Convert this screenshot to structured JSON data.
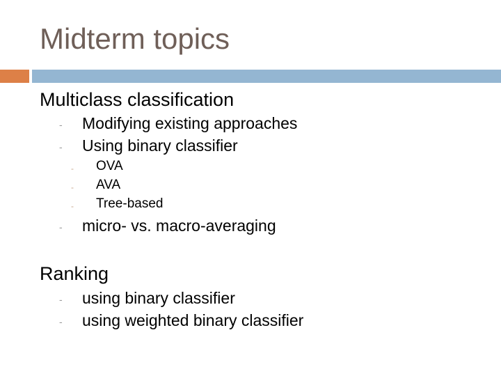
{
  "slide": {
    "title": "Midterm topics",
    "accent_colors": {
      "left_block": "#dd8047",
      "bar": "#94b6d2",
      "title_text": "#6f5f58"
    },
    "sections": [
      {
        "heading": "Multiclass classification",
        "items": [
          {
            "bullet": "-",
            "text": "Modifying existing approaches"
          },
          {
            "bullet": "-",
            "text": "Using binary classifier",
            "subitems": [
              {
                "bullet": "-",
                "text": "OVA"
              },
              {
                "bullet": "-",
                "text": "AVA"
              },
              {
                "bullet": "-",
                "text": "Tree-based"
              }
            ]
          },
          {
            "bullet": "-",
            "text": "micro- vs. macro-averaging"
          }
        ]
      },
      {
        "heading": "Ranking",
        "items": [
          {
            "bullet": "-",
            "text": "using binary classifier"
          },
          {
            "bullet": "-",
            "text": "using weighted binary classifier"
          }
        ]
      }
    ]
  }
}
